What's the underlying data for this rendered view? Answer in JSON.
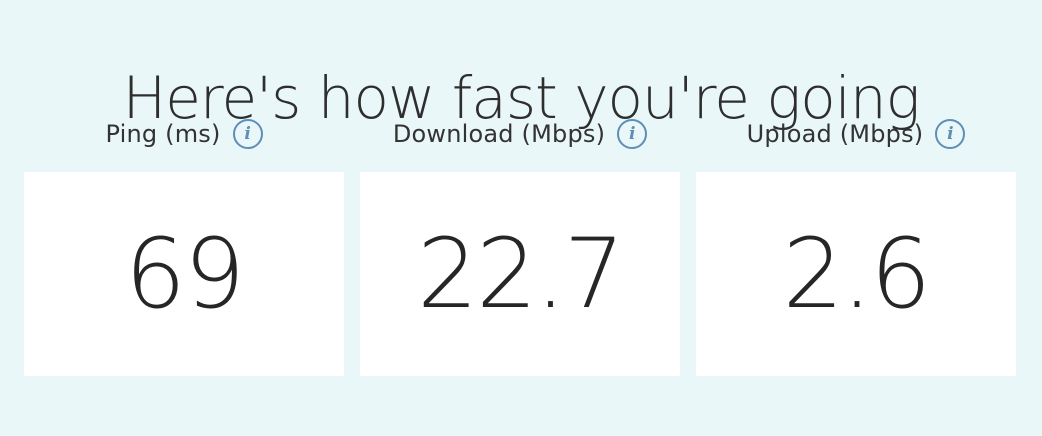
{
  "headline": "Here's how fast you're going",
  "metrics": {
    "ping": {
      "label": "Ping (ms)",
      "value": "69",
      "info_icon": "info-icon"
    },
    "download": {
      "label": "Download (Mbps)",
      "value": "22.7",
      "info_icon": "info-icon"
    },
    "upload": {
      "label": "Upload (Mbps)",
      "value": "2.6",
      "info_icon": "info-icon"
    }
  },
  "info_glyph": "i",
  "colors": {
    "background": "#eaf7f9",
    "card": "#ffffff",
    "info_icon": "#5e8fb7",
    "text": "#2b2b2b"
  }
}
